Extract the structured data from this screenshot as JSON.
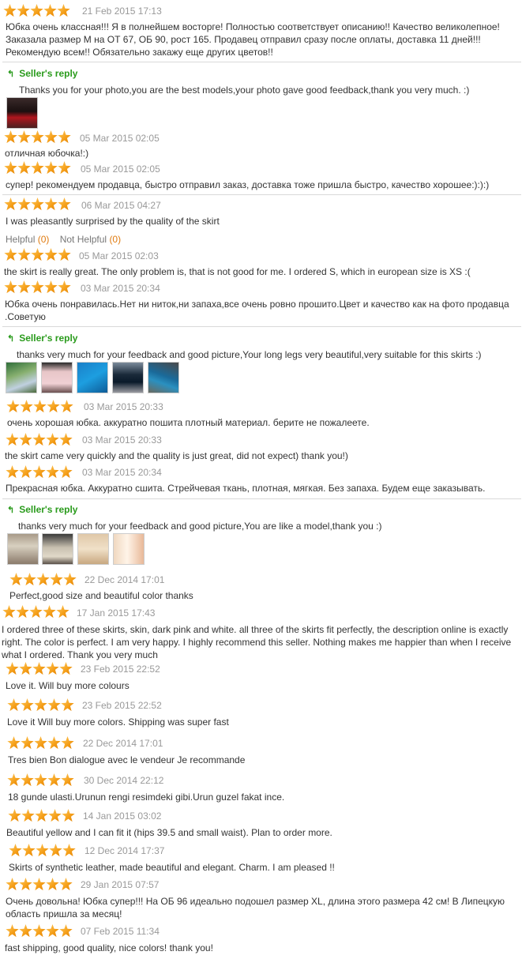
{
  "reviews": [
    {
      "date": "21 Feb 2015 17:13",
      "rating": 5,
      "text": "Юбка очень классная!!! Я в полнейшем восторге! Полностью соответствует описанию!! Качество великолепное! Заказала размер М на ОТ 67, ОБ 90, рост 165. Продавец отправил сразу после оплаты, доставка 11 дней!!! Рекомендую всем!! Обязательно закажу еще других цветов!!"
    },
    {
      "date": "05 Mar 2015 02:05",
      "rating": 5,
      "text": "отличная юбочка!:)"
    },
    {
      "date": "05 Mar 2015 02:05",
      "rating": 5,
      "text": "супер! рекомендуем продавца, быстро отправил заказ, доставка тоже пришла быстро, качество хорошее:):):)"
    },
    {
      "date": "06 Mar 2015 04:27",
      "rating": 5,
      "text": "I was pleasantly surprised by the quality of the skirt"
    },
    {
      "date": "05 Mar 2015 02:03",
      "rating": 5,
      "text": "the skirt is really great. The only problem is, that is not good for me. I ordered S, which in european size is XS :("
    },
    {
      "date": "03 Mar 2015 20:34",
      "rating": 5,
      "text": "Юбка очень понравилась.Нет ни ниток,ни запаха,все очень ровно прошито.Цвет и качество как на фото продавца .Советую"
    },
    {
      "date": "03 Mar 2015 20:33",
      "rating": 5,
      "text": "очень хорошая юбка. аккуратно пошита плотный материал. берите не пожалеете."
    },
    {
      "date": "03 Mar 2015 20:33",
      "rating": 5,
      "text": "the skirt came very quickly and the quality is just great, did not expect) thank you!)"
    },
    {
      "date": "03 Mar 2015 20:34",
      "rating": 5,
      "text": "Прекрасная юбка. Аккуратно сшита. Стрейчевая ткань, плотная, мягкая. Без запаха. Будем еще заказывать."
    },
    {
      "date": "22 Dec 2014 17:01",
      "rating": 5,
      "text": "Perfect,good size and beautiful color thanks"
    },
    {
      "date": "17 Jan 2015 17:43",
      "rating": 5,
      "text": "I ordered three of these skirts, skin, dark pink and white. all three of the skirts fit perfectly, the description online is exactly right. The color is perfect. I am very happy. I highly recommend this seller. Nothing makes me happier than when I receive what I ordered. Thank you very much"
    },
    {
      "date": "23 Feb 2015 22:52",
      "rating": 5,
      "text": "Love it. Will buy more colours"
    },
    {
      "date": "23 Feb 2015 22:52",
      "rating": 5,
      "text": "Love it Will buy more colors. Shipping was super fast"
    },
    {
      "date": "22 Dec 2014 17:01",
      "rating": 5,
      "text": "Tres bien Bon dialogue avec le vendeur Je recommande"
    },
    {
      "date": "30 Dec 2014 22:12",
      "rating": 5,
      "text": "18 gunde ulasti.Urunun rengi resimdeki gibi.Urun guzel fakat ince."
    },
    {
      "date": "14 Jan 2015 03:02",
      "rating": 5,
      "text": "Beautiful yellow and I can fit it (hips 39.5 and small waist). Plan to order more."
    },
    {
      "date": "12 Dec 2014 17:37",
      "rating": 5,
      "text": "Skirts of synthetic leather, made beautiful and elegant. Charm. I am pleased !!"
    },
    {
      "date": "29 Jan 2015 07:57",
      "rating": 5,
      "text": "Очень довольна! Юбка супер!!! На ОБ 96 идеально подошел размер XL, длина этого размера 42 см! В Липецкую область пришла за месяц!"
    },
    {
      "date": "07 Feb 2015 11:34",
      "rating": 5,
      "text": "fast shipping, good quality, nice colors! thank you!"
    }
  ],
  "seller_replies": [
    {
      "label": "Seller's reply",
      "text": "Thanks you for your photo,you are the best models,your photo gave good feedback,thank you very much. :)"
    },
    {
      "label": "Seller's reply",
      "text": "thanks very much for your feedback and good picture,Your long legs very beautiful,very suitable for this skirts :)"
    },
    {
      "label": "Seller's reply",
      "text": "thanks very much for your feedback and good picture,You are like a model,thank you :)"
    }
  ],
  "helpful": {
    "helpful_label": "Helpful",
    "helpful_count": "(0)",
    "not_helpful_label": "Not Helpful",
    "not_helpful_count": "(0)"
  },
  "colors": {
    "star": "#f5a01a",
    "reply_green": "#2a9b1c",
    "date_grey": "#999999",
    "count_orange": "#e07b10"
  }
}
